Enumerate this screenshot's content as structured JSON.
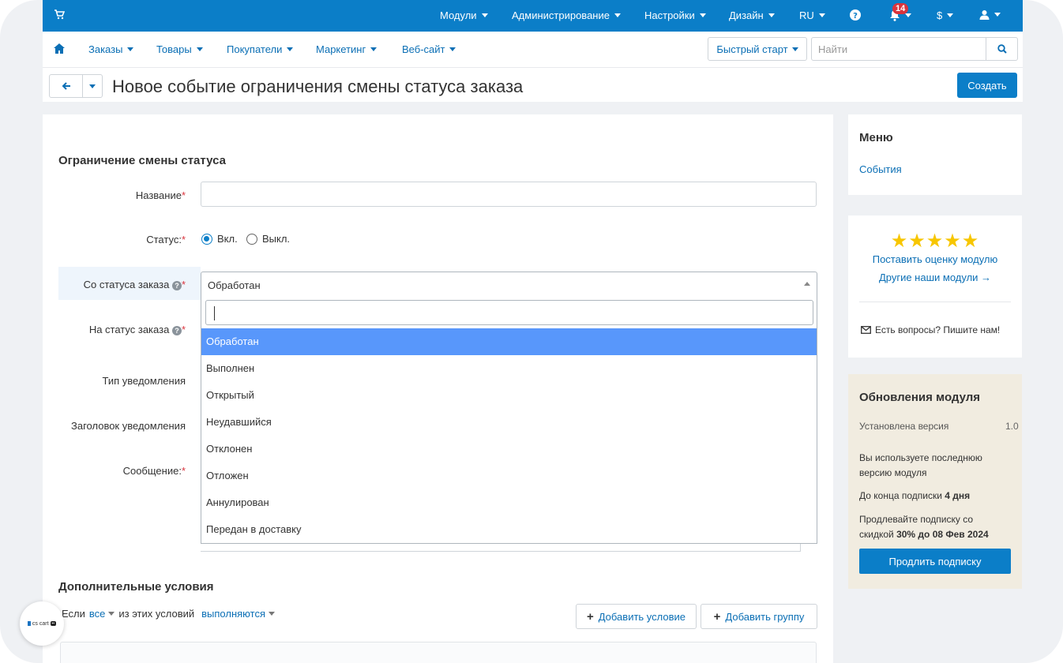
{
  "topbar": {
    "menus": [
      "Модули",
      "Администрирование",
      "Настройки",
      "Дизайн",
      "RU"
    ],
    "notifications_count": "14",
    "currency": "$"
  },
  "subnav": {
    "items": [
      "Заказы",
      "Товары",
      "Покупатели",
      "Маркетинг",
      "Веб-сайт"
    ],
    "quick_start": "Быстрый старт",
    "search_placeholder": "Найти"
  },
  "titlebar": {
    "title": "Новое событие ограничения смены статуса заказа",
    "create_label": "Создать"
  },
  "form": {
    "section_title": "Ограничение смены статуса",
    "name_label": "Название",
    "status_label": "Статус:",
    "status_on": "Вкл.",
    "status_off": "Выкл.",
    "status_value": "on",
    "from_status_label": "Со статуса заказа",
    "from_status_value": "Обработан",
    "to_status_label": "На статус заказа",
    "notify_type_label": "Тип уведомления",
    "notify_title_label": "Заголовок уведомления",
    "message_label": "Сообщение:",
    "required_mark": "*"
  },
  "dropdown": {
    "options": [
      "Обработан",
      "Выполнен",
      "Открытый",
      "Неудавшийся",
      "Отклонен",
      "Отложен",
      "Аннулирован",
      "Передан в доставку"
    ],
    "selected_index": 0
  },
  "conditions": {
    "title": "Дополнительные условия",
    "prefix": "Если",
    "all": "все",
    "middle": "из этих условий",
    "met": "выполняются",
    "add_condition": "Добавить условие",
    "add_group": "Добавить группу"
  },
  "sidebar": {
    "menu_title": "Меню",
    "menu_link": "События",
    "rate_link": "Поставить оценку модулю",
    "other_modules": "Другие наши модули →",
    "contact": "Есть вопросы? Пишите нам!",
    "rating_stars": 5
  },
  "updates": {
    "title": "Обновления модуля",
    "installed_label": "Установлена версия",
    "installed_value": "1.0",
    "latest_line1": "Вы используете последнюю",
    "latest_line2": "версию модуля",
    "sub_prefix": "До конца подписки",
    "sub_days": "4 дня",
    "promo_line1": "Продлевайте подписку со",
    "promo_prefix": "скидкой",
    "promo_bold": "30% до 08 Фев 2024",
    "renew_label": "Продлить подписку"
  },
  "logo": {
    "text": "cs cart"
  },
  "colors": {
    "primary": "#0b7ec8",
    "link": "#0b6fb5",
    "selected": "#5897fb",
    "required": "#d9343d",
    "star": "#f7c600"
  }
}
